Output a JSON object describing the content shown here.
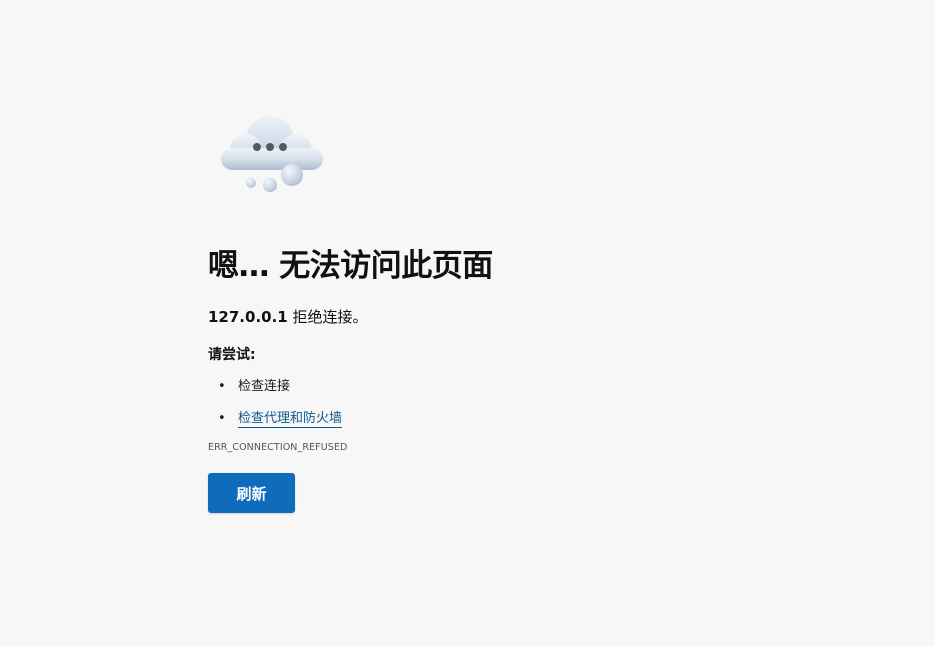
{
  "error_page": {
    "title": "嗯… 无法访问此页面",
    "host": "127.0.0.1",
    "message": "拒绝连接。",
    "try_label": "请尝试:",
    "suggestions": [
      {
        "label": "检查连接",
        "is_link": false
      },
      {
        "label": "检查代理和防火墙",
        "is_link": true
      }
    ],
    "bullet": "•",
    "error_code": "ERR_CONNECTION_REFUSED",
    "refresh_label": "刷新"
  },
  "colors": {
    "background": "#f7f7f7",
    "button": "#0f6cbd",
    "link": "#0f5a8e"
  },
  "icons": {
    "illustration": "cloud-thinking-icon"
  }
}
